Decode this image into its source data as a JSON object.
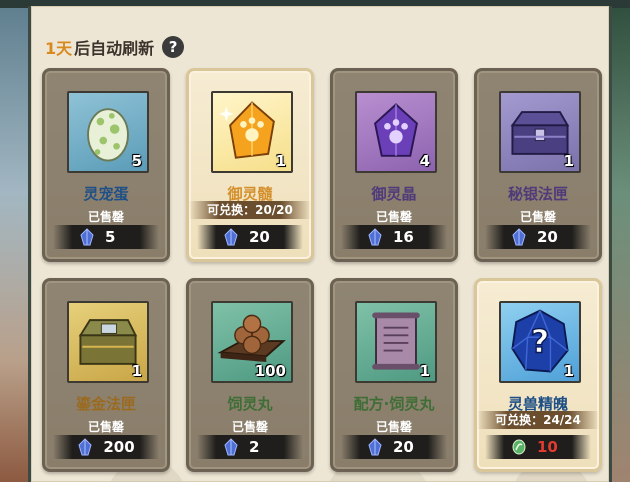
{
  "header": {
    "days": "1天",
    "text": "后自动刷新",
    "help_icon": "?"
  },
  "cards": [
    {
      "name": "灵宠蛋",
      "qty": "5",
      "status": "已售罄",
      "price": "5",
      "currency": "blue-crystal-icon"
    },
    {
      "name": "御灵髓",
      "qty": "1",
      "exchange": "可兑换：20/20",
      "price": "20",
      "currency": "blue-crystal-icon"
    },
    {
      "name": "御灵晶",
      "qty": "4",
      "status": "已售罄",
      "price": "16",
      "currency": "blue-crystal-icon"
    },
    {
      "name": "秘银法匣",
      "qty": "1",
      "status": "已售罄",
      "price": "20",
      "currency": "blue-crystal-icon"
    },
    {
      "name": "鎏金法匣",
      "qty": "1",
      "status": "已售罄",
      "price": "200",
      "currency": "blue-crystal-icon"
    },
    {
      "name": "饲灵丸",
      "qty": "100",
      "status": "已售罄",
      "price": "2",
      "currency": "blue-crystal-icon"
    },
    {
      "name": "配方·饲灵丸",
      "qty": "1",
      "status": "已售罄",
      "price": "20",
      "currency": "blue-crystal-icon"
    },
    {
      "name": "灵兽精魄",
      "qty": "1",
      "exchange": "可兑换：24/24",
      "price": "10",
      "currency": "green-jade-icon"
    }
  ],
  "colors": {
    "accent_gold": "#d98a1f",
    "name_blue": "#1e4f86",
    "price_red": "#e23b2f"
  }
}
